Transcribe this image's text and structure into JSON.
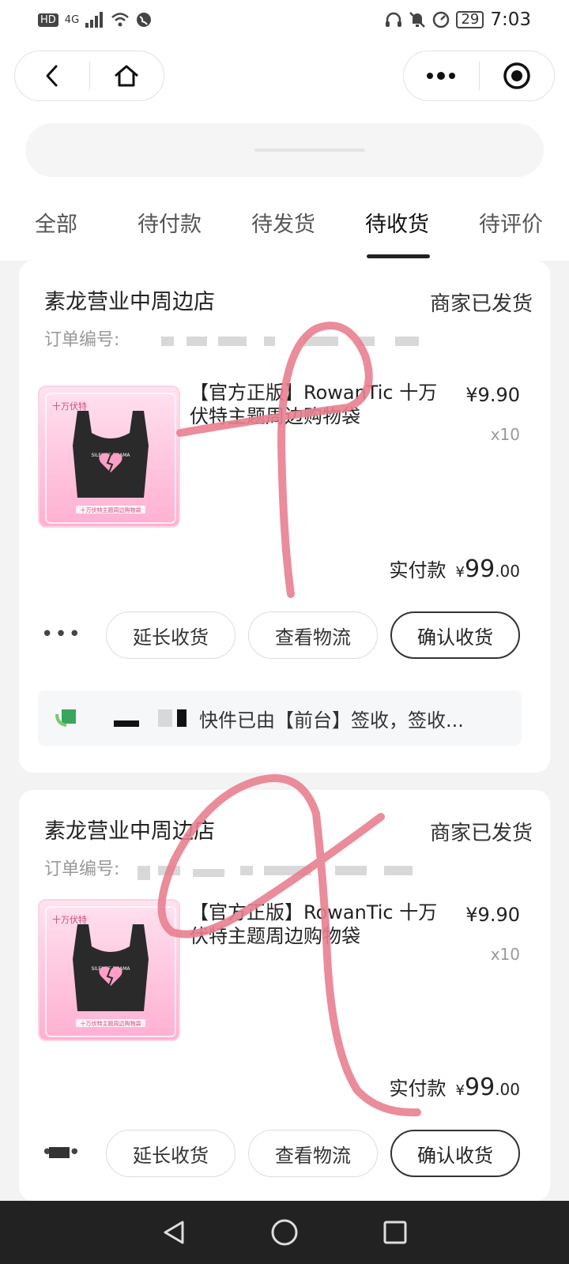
{
  "status_bar": {
    "hd": "HD",
    "network": "4G",
    "battery": "29",
    "time": "7:03"
  },
  "tabs": [
    {
      "label": "全部"
    },
    {
      "label": "待付款"
    },
    {
      "label": "待发货"
    },
    {
      "label": "待收货"
    },
    {
      "label": "待评价"
    }
  ],
  "active_tab": "待收货",
  "orders": [
    {
      "store": "素龙营业中周边店",
      "status": "商家已发货",
      "order_label": "订单编号:",
      "product_name": "【官方正版】RowanTic 十万伏特主题周边购物袋",
      "price": "¥9.90",
      "qty": "x10",
      "paid_label": "实付款",
      "paid_yen": "¥",
      "paid_amount": "99",
      "paid_decimal": ".00",
      "buttons": {
        "extend": "延长收货",
        "logistics": "查看物流",
        "confirm": "确认收货"
      },
      "more": "•••",
      "logistics_text": "快件已由【前台】签收，签收..."
    },
    {
      "store": "素龙营业中周边店",
      "status": "商家已发货",
      "order_label": "订单编号:",
      "product_name": "【官方正版】RowanTic 十万伏特主题周边购物袋",
      "price": "¥9.90",
      "qty": "x10",
      "paid_label": "实付款",
      "paid_yen": "¥",
      "paid_amount": "99",
      "paid_decimal": ".00",
      "buttons": {
        "extend": "延长收货",
        "logistics": "查看物流",
        "confirm": "确认收货"
      },
      "more": "•••"
    }
  ],
  "thumbnail": {
    "brand": "十万伏特",
    "bag_text": "SILENCE DRAMA",
    "banner": "十万伏特主题周边购物袋"
  },
  "colors": {
    "scribble": "#e8808f",
    "thumb_pink": "#ffc3dd",
    "navbar": "#222222"
  },
  "icons": [
    "back-icon",
    "home-icon",
    "more-dots-icon",
    "target-icon",
    "nav-back-icon",
    "nav-home-icon",
    "nav-recent-icon"
  ]
}
